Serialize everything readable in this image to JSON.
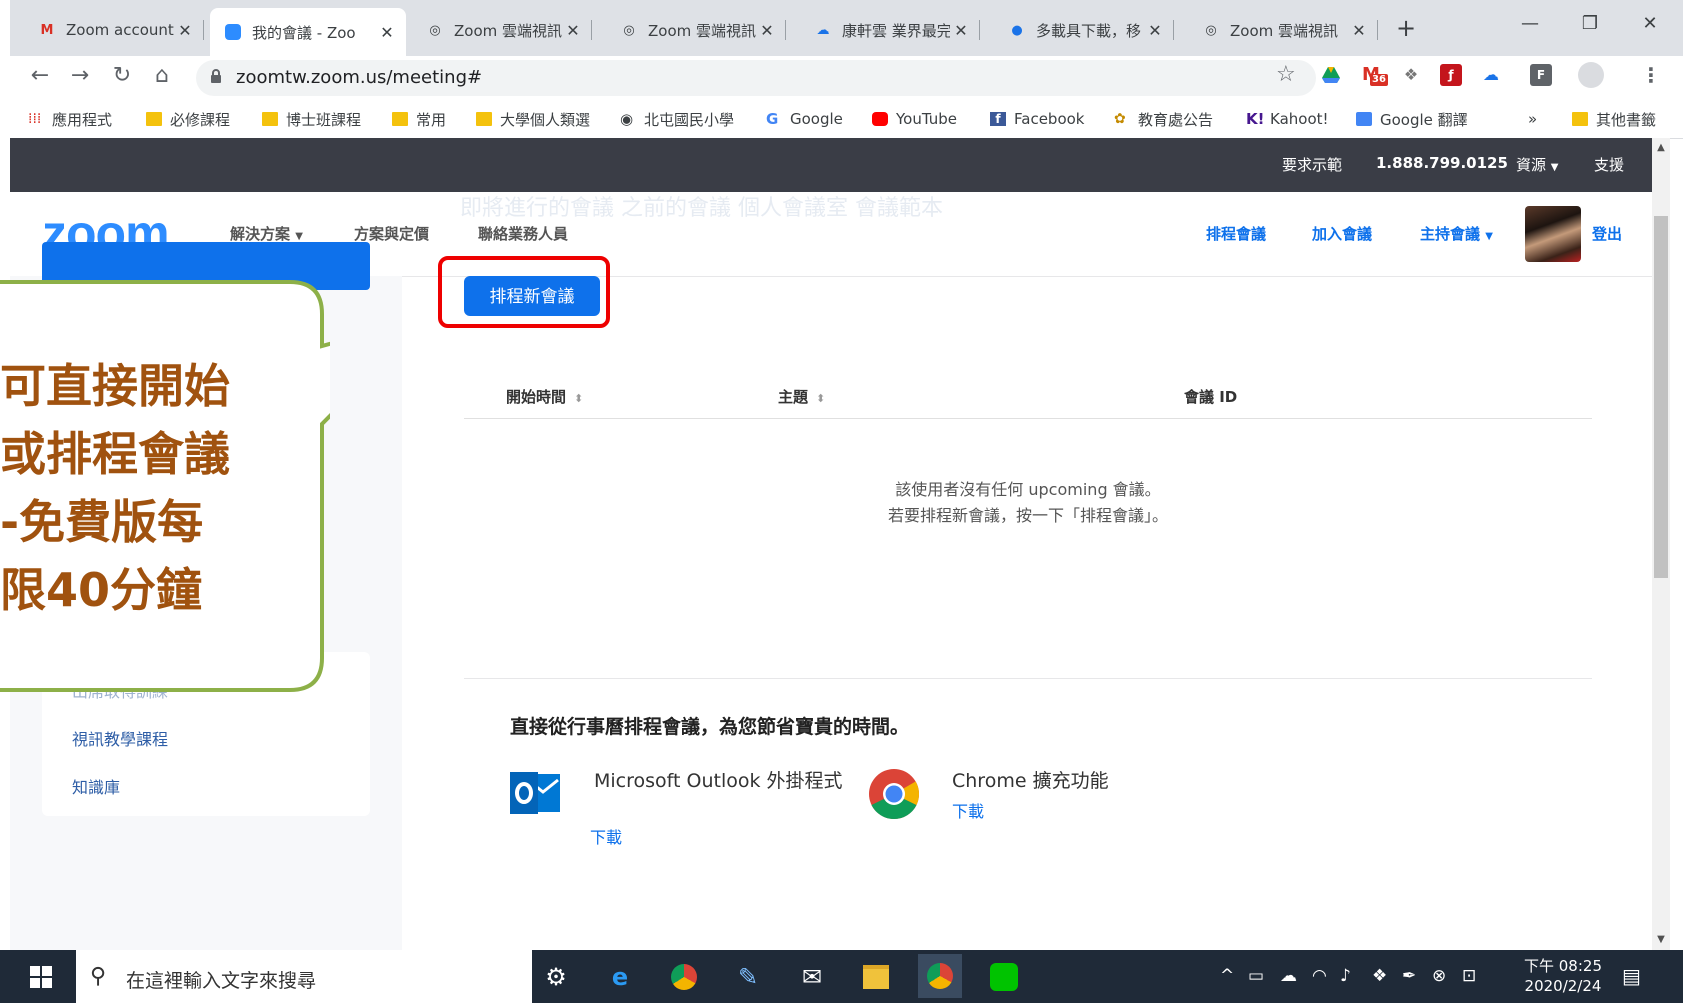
{
  "browser": {
    "tabs": [
      {
        "title": "Zoom account",
        "icon": "gmail-icon"
      },
      {
        "title": "我的會議 - Zoo",
        "icon": "zoom-icon",
        "active": true
      },
      {
        "title": "Zoom 雲端視訊",
        "icon": "zoom-icon"
      },
      {
        "title": "Zoom 雲端視訊",
        "icon": "zoom-icon"
      },
      {
        "title": "康軒雲 業界最完",
        "icon": "cloud-icon"
      },
      {
        "title": "多載具下載，移",
        "icon": "app-icon"
      },
      {
        "title": "Zoom 雲端視訊",
        "icon": "zoom-icon"
      }
    ],
    "url": "zoomtw.zoom.us/meeting#",
    "extension_badge": "36",
    "bookmarks": [
      {
        "label": "應用程式",
        "icon": "apps-grid-icon"
      },
      {
        "label": "必修課程",
        "icon": "folder-icon"
      },
      {
        "label": "博士班課程",
        "icon": "folder-icon"
      },
      {
        "label": "常用",
        "icon": "folder-icon"
      },
      {
        "label": "大學個人類選",
        "icon": "folder-icon"
      },
      {
        "label": "北屯國民小學",
        "icon": "globe-icon"
      },
      {
        "label": "Google",
        "icon": "google-icon"
      },
      {
        "label": "YouTube",
        "icon": "youtube-icon"
      },
      {
        "label": "Facebook",
        "icon": "facebook-icon"
      },
      {
        "label": "教育處公告",
        "icon": "edu-icon"
      },
      {
        "label": "Kahoot!",
        "icon": "kahoot-icon"
      },
      {
        "label": "Google 翻譯",
        "icon": "translate-icon"
      }
    ],
    "bookmarks_more": "»",
    "other_bookmarks": "其他書籤"
  },
  "zoom": {
    "topbar": {
      "demo": "要求示範",
      "phone": "1.888.799.0125",
      "resources": "資源",
      "support": "支援"
    },
    "logo": "zoom",
    "nav": {
      "solutions": "解決方案",
      "plans": "方案與定價",
      "sales": "聯絡業務人員"
    },
    "actions": {
      "schedule": "排程會議",
      "join": "加入會議",
      "host": "主持會議",
      "signout": "登出"
    },
    "ghost_tabs": "即將進行的會議     之前的會議     個人會議室     會議範本",
    "schedule_new": "排程新會議",
    "table": {
      "col_start": "開始時間",
      "col_topic": "主題",
      "col_id": "會議 ID"
    },
    "empty_line1": "該使用者沒有任何 upcoming 會議。",
    "empty_line2": "若要排程新會議，按一下「排程會議」。",
    "sidebar": {
      "links": [
        "視訊教學課程",
        "知識庫"
      ],
      "partial": "出席取得訓練"
    },
    "calendar": {
      "heading": "直接從行事曆排程會議，為您節省寶貴的時間。",
      "outlook_title": "Microsoft Outlook 外掛程式",
      "outlook_download": "下載",
      "chrome_title": "Chrome 擴充功能",
      "chrome_download": "下載"
    }
  },
  "callout": {
    "lines": [
      "可直接開始",
      "或排程會議",
      "-免費版每",
      "限40分鐘"
    ],
    "text_color": "#a0520f",
    "border_color": "#8db048"
  },
  "taskbar": {
    "search_placeholder": "在這裡輸入文字來搜尋",
    "time": "下午 08:25",
    "date": "2020/2/24"
  },
  "colors": {
    "zoom_blue": "#0e71eb",
    "topbar": "#3a3d46",
    "highlight": "#ee0000"
  }
}
